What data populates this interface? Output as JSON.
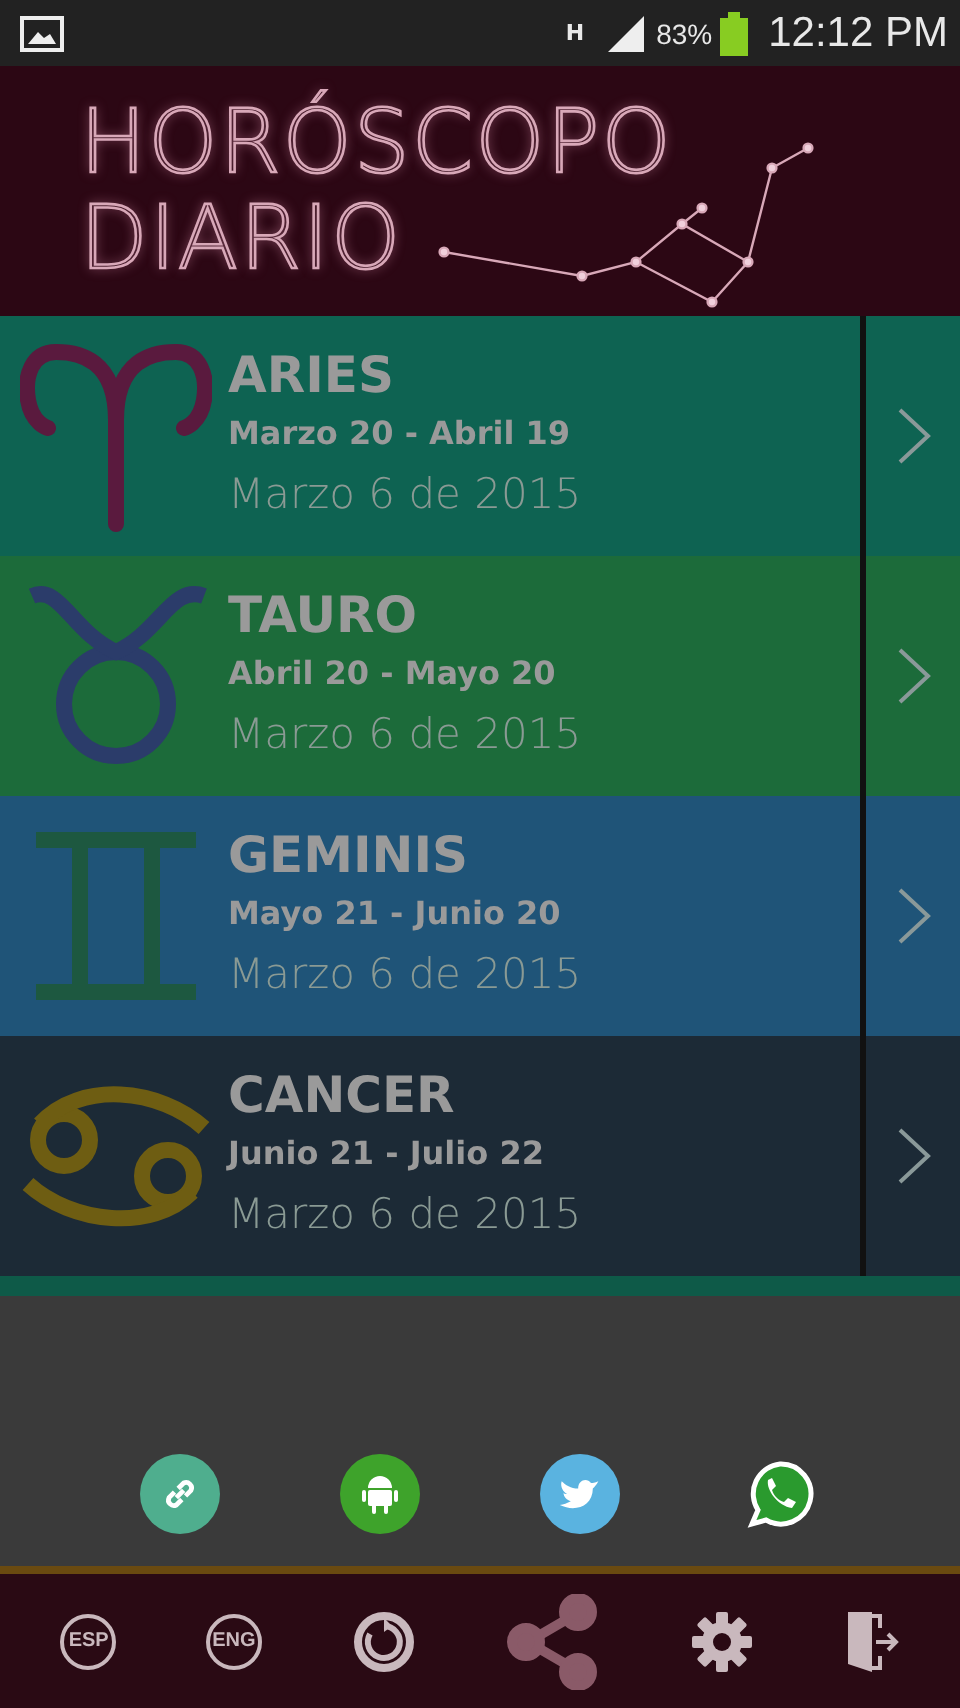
{
  "status_bar": {
    "network": "H",
    "battery": "83%",
    "time": "12:12 PM"
  },
  "header": {
    "title_lines": [
      "HORÓSCOPO",
      "DIARIO"
    ]
  },
  "signs": [
    {
      "kind": "aries",
      "name": "ARIES",
      "range": "Marzo 20 - Abril 19",
      "date": "Marzo 6 de 2015",
      "color": "#0e6352"
    },
    {
      "kind": "taurus",
      "name": "TAURO",
      "range": "Abril 20 - Mayo 20",
      "date": "Marzo 6 de 2015",
      "color": "#1c6b3a"
    },
    {
      "kind": "gemini",
      "name": "GEMINIS",
      "range": "Mayo 21 - Junio 20",
      "date": "Marzo 6 de 2015",
      "color": "#1f5478"
    },
    {
      "kind": "cancer",
      "name": "CANCER",
      "range": "Junio 21 - Julio 22",
      "date": "Marzo 6 de 2015",
      "color": "#1c2a36"
    }
  ],
  "share_sheet": {
    "targets": [
      {
        "kind": "link"
      },
      {
        "kind": "android"
      },
      {
        "kind": "bird"
      },
      {
        "kind": "chat"
      }
    ]
  },
  "bottom_bar": [
    {
      "kind": "text",
      "label": "ESP",
      "selected": false
    },
    {
      "kind": "text",
      "label": "ENG",
      "selected": false
    },
    {
      "kind": "refresh",
      "selected": false
    },
    {
      "kind": "share",
      "selected": true
    },
    {
      "kind": "settings",
      "selected": false
    },
    {
      "kind": "exit",
      "selected": false
    }
  ]
}
